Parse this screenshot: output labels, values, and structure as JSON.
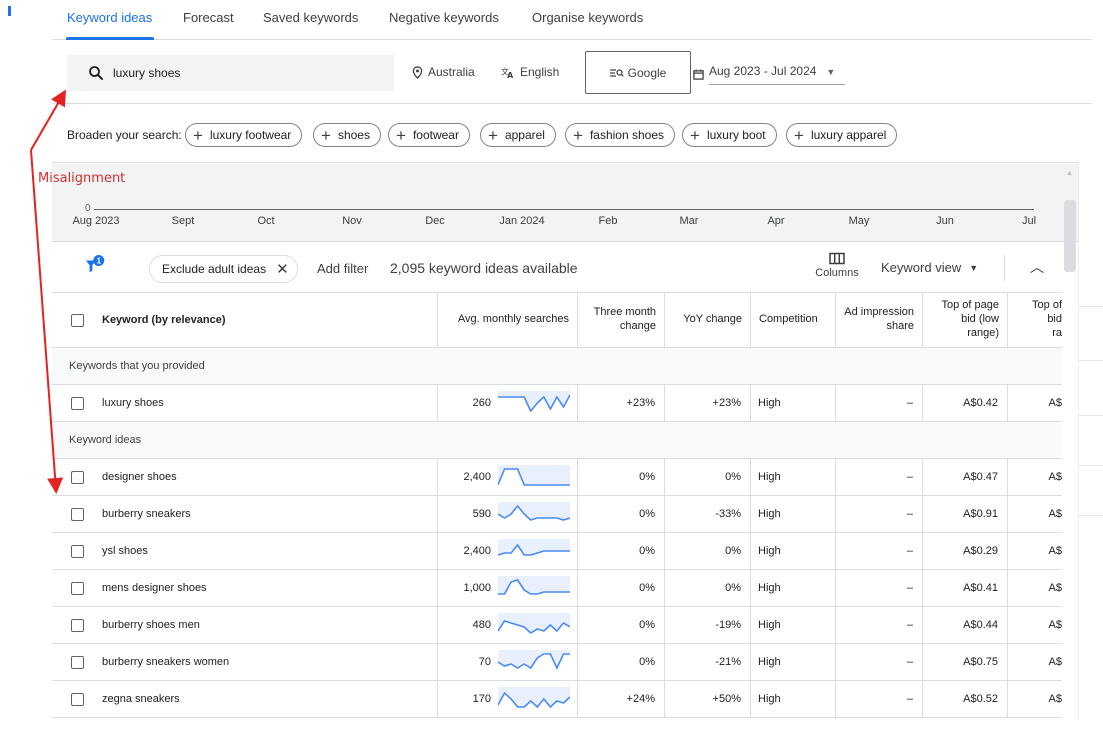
{
  "tabs": [
    {
      "label": "Keyword ideas",
      "active": true
    },
    {
      "label": "Forecast"
    },
    {
      "label": "Saved keywords"
    },
    {
      "label": "Negative keywords"
    },
    {
      "label": "Organise keywords"
    }
  ],
  "search": {
    "query": "luxury shoes",
    "location": "Australia",
    "language": "English",
    "engine": "Google",
    "date_range": "Aug 2023 - Jul 2024"
  },
  "broaden": {
    "label": "Broaden your search:",
    "chips": [
      "luxury footwear",
      "shoes",
      "footwear",
      "apparel",
      "fashion shoes",
      "luxury boot",
      "luxury apparel"
    ]
  },
  "chart": {
    "zero_label": "0",
    "months": [
      "Aug 2023",
      "Sept",
      "Oct",
      "Nov",
      "Dec",
      "Jan 2024",
      "Feb",
      "Mar",
      "Apr",
      "May",
      "Jun",
      "Jul"
    ]
  },
  "toolbar": {
    "filter_badge": "1",
    "exclude_chip": "Exclude adult ideas",
    "add_filter": "Add filter",
    "ideas_count": "2,095 keyword ideas available",
    "columns": "Columns",
    "keyword_view": "Keyword view"
  },
  "table": {
    "headers": {
      "keyword": "Keyword (by relevance)",
      "avg": "Avg. monthly searches",
      "three_month_1": "Three month",
      "three_month_2": "change",
      "yoy": "YoY change",
      "competition": "Competition",
      "ad_imp_1": "Ad impression",
      "ad_imp_2": "share",
      "top_low_1": "Top of page",
      "top_low_2": "bid (low",
      "top_low_3": "range)",
      "top_high_1": "Top of",
      "top_high_2": "bid",
      "top_high_3": "ra"
    },
    "section_provided": "Keywords that you provided",
    "section_ideas": "Keyword ideas",
    "provided": [
      {
        "keyword": "luxury shoes",
        "avg": "260",
        "three_month": "+23%",
        "yoy": "+23%",
        "competition": "High",
        "ad_share": "–",
        "bid_low": "A$0.42",
        "bid_high": "A$",
        "trend": [
          0.2,
          0.2,
          0.2,
          0.2,
          0.2,
          0.9,
          0.5,
          0.2,
          0.8,
          0.2,
          0.7,
          0.1
        ]
      }
    ],
    "ideas": [
      {
        "keyword": "designer shoes",
        "avg": "2,400",
        "three_month": "0%",
        "yoy": "0%",
        "competition": "High",
        "ad_share": "–",
        "bid_low": "A$0.47",
        "bid_high": "A$",
        "trend": [
          0.9,
          0.1,
          0.1,
          0.1,
          0.9,
          0.9,
          0.9,
          0.9,
          0.9,
          0.9,
          0.9,
          0.9
        ]
      },
      {
        "keyword": "burberry sneakers",
        "avg": "590",
        "three_month": "0%",
        "yoy": "-33%",
        "competition": "High",
        "ad_share": "–",
        "bid_low": "A$0.91",
        "bid_high": "A$",
        "trend": [
          0.5,
          0.7,
          0.5,
          0.1,
          0.5,
          0.8,
          0.7,
          0.7,
          0.7,
          0.7,
          0.8,
          0.7
        ]
      },
      {
        "keyword": "ysl shoes",
        "avg": "2,400",
        "three_month": "0%",
        "yoy": "0%",
        "competition": "High",
        "ad_share": "–",
        "bid_low": "A$0.29",
        "bid_high": "A$",
        "trend": [
          0.7,
          0.6,
          0.6,
          0.2,
          0.7,
          0.7,
          0.6,
          0.5,
          0.5,
          0.5,
          0.5,
          0.5
        ]
      },
      {
        "keyword": "mens designer shoes",
        "avg": "1,000",
        "three_month": "0%",
        "yoy": "0%",
        "competition": "High",
        "ad_share": "–",
        "bid_low": "A$0.41",
        "bid_high": "A$",
        "trend": [
          0.8,
          0.8,
          0.2,
          0.1,
          0.6,
          0.8,
          0.8,
          0.7,
          0.7,
          0.7,
          0.7,
          0.7
        ]
      },
      {
        "keyword": "burberry shoes men",
        "avg": "480",
        "three_month": "0%",
        "yoy": "-19%",
        "competition": "High",
        "ad_share": "–",
        "bid_low": "A$0.44",
        "bid_high": "A$",
        "trend": [
          0.8,
          0.3,
          0.4,
          0.5,
          0.6,
          0.9,
          0.7,
          0.8,
          0.5,
          0.8,
          0.4,
          0.6
        ]
      },
      {
        "keyword": "burberry sneakers women",
        "avg": "70",
        "three_month": "0%",
        "yoy": "-21%",
        "competition": "High",
        "ad_share": "–",
        "bid_low": "A$0.75",
        "bid_high": "A$",
        "trend": [
          0.5,
          0.7,
          0.6,
          0.8,
          0.6,
          0.8,
          0.3,
          0.1,
          0.1,
          0.8,
          0.1,
          0.1
        ]
      },
      {
        "keyword": "zegna sneakers",
        "avg": "170",
        "three_month": "+24%",
        "yoy": "+50%",
        "competition": "High",
        "ad_share": "–",
        "bid_low": "A$0.52",
        "bid_high": "A$",
        "trend": [
          0.8,
          0.2,
          0.5,
          0.9,
          0.9,
          0.6,
          0.9,
          0.5,
          0.9,
          0.6,
          0.7,
          0.4
        ]
      }
    ]
  },
  "annotation": {
    "text": "Misalignment",
    "color": "#d32f2f"
  },
  "colors": {
    "accent": "#1a73e8",
    "spark_line": "#4a8af4",
    "spark_fill": "#e8f0fe"
  }
}
